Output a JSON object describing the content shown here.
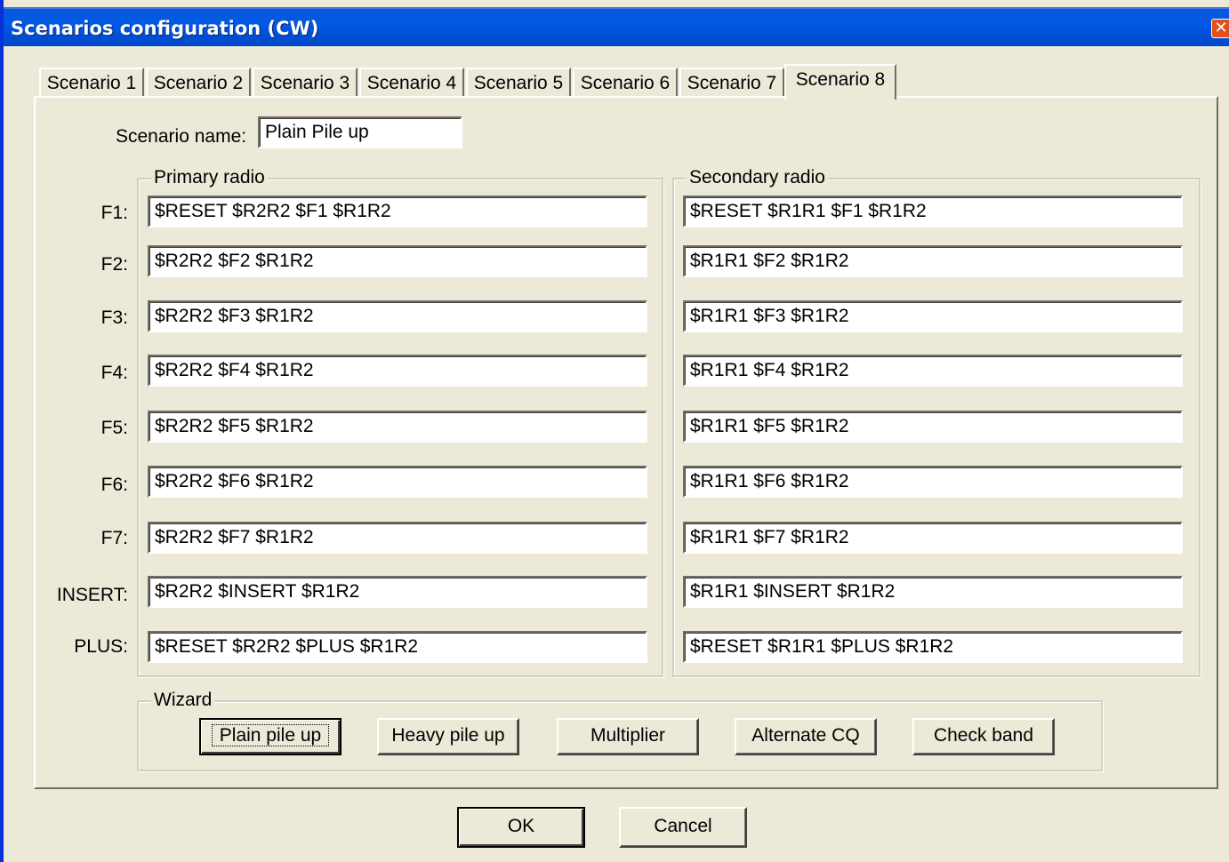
{
  "window": {
    "title": "Scenarios configuration (CW)",
    "close_icon": "close-icon"
  },
  "tabs": [
    {
      "label": "Scenario 1"
    },
    {
      "label": "Scenario 2"
    },
    {
      "label": "Scenario 3"
    },
    {
      "label": "Scenario 4"
    },
    {
      "label": "Scenario 5"
    },
    {
      "label": "Scenario 6"
    },
    {
      "label": "Scenario 7"
    },
    {
      "label": "Scenario 8",
      "active": true
    }
  ],
  "scenario": {
    "name_label": "Scenario name:",
    "name_value": "Plain Pile up"
  },
  "primary": {
    "title": "Primary radio",
    "rows": [
      {
        "key": "F1:",
        "value": "$RESET $R2R2 $F1 $R1R2"
      },
      {
        "key": "F2:",
        "value": "$R2R2 $F2 $R1R2"
      },
      {
        "key": "F3:",
        "value": "$R2R2 $F3 $R1R2"
      },
      {
        "key": "F4:",
        "value": "$R2R2 $F4 $R1R2"
      },
      {
        "key": "F5:",
        "value": "$R2R2 $F5 $R1R2"
      },
      {
        "key": "F6:",
        "value": "$R2R2 $F6 $R1R2"
      },
      {
        "key": "F7:",
        "value": "$R2R2 $F7 $R1R2"
      },
      {
        "key": "INSERT:",
        "value": "$R2R2 $INSERT $R1R2"
      },
      {
        "key": "PLUS:",
        "value": "$RESET $R2R2 $PLUS $R1R2"
      }
    ]
  },
  "secondary": {
    "title": "Secondary radio",
    "rows": [
      {
        "value": "$RESET $R1R1 $F1 $R1R2"
      },
      {
        "value": "$R1R1 $F2 $R1R2"
      },
      {
        "value": "$R1R1 $F3 $R1R2"
      },
      {
        "value": "$R1R1 $F4 $R1R2"
      },
      {
        "value": "$R1R1 $F5 $R1R2"
      },
      {
        "value": "$R1R1 $F6 $R1R2"
      },
      {
        "value": "$R1R1 $F7 $R1R2"
      },
      {
        "value": "$R1R1 $INSERT $R1R2"
      },
      {
        "value": "$RESET $R1R1 $PLUS $R1R2"
      }
    ]
  },
  "wizard": {
    "title": "Wizard",
    "buttons": [
      {
        "label": "Plain pile up"
      },
      {
        "label": "Heavy pile up"
      },
      {
        "label": "Multiplier"
      },
      {
        "label": "Alternate CQ"
      },
      {
        "label": "Check band"
      }
    ]
  },
  "footer": {
    "ok_label": "OK",
    "cancel_label": "Cancel"
  }
}
